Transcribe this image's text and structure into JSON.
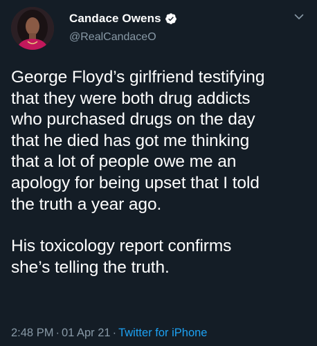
{
  "author": {
    "display_name": "Candace Owens",
    "handle": "@RealCandaceO",
    "verified": true,
    "avatar_icon": "profile-photo",
    "verified_icon": "verified-badge-icon",
    "verified_color": "#ffffff"
  },
  "tweet": {
    "paragraph_1": "George Floyd’s girlfriend testifying\nthat they were both drug addicts\nwho purchased drugs on the day\nthat he died has got me thinking\nthat a lot of people owe me an\napology for being upset that I told\nthe truth a year ago.",
    "paragraph_2": "His toxicology report confirms\nshe’s telling the truth."
  },
  "meta": {
    "time": "2:48 PM",
    "separator": "·",
    "date": "01 Apr 21",
    "source": "Twitter for iPhone"
  },
  "menu_icon": "chevron-down-icon",
  "colors": {
    "background": "#141d26",
    "text": "#ffffff",
    "secondary_text": "#8899a6",
    "link": "#1da1f2"
  }
}
